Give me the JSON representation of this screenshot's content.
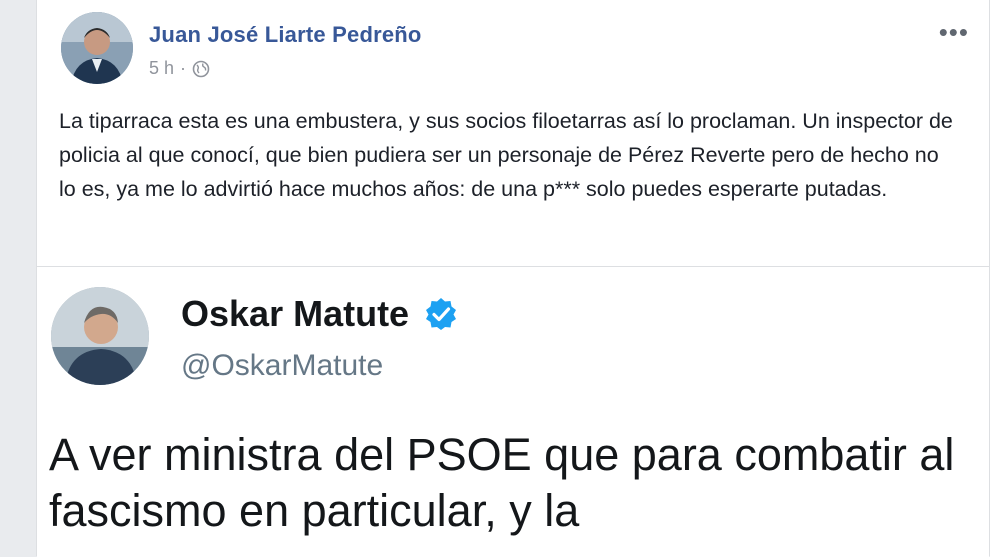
{
  "post": {
    "author": "Juan José Liarte Pedreño",
    "timestamp": "5 h",
    "separator": "·",
    "privacy_icon": "globe-icon",
    "more_label": "•••",
    "text": "La tiparraca esta es una embustera, y sus socios filoetarras así lo proclaman. Un inspector de policia al que conocí, que bien pudiera ser un personaje de Pérez Reverte pero de hecho no lo es, ya me lo advirtió hace muchos años: de una p*** solo puedes esperarte putadas."
  },
  "tweet": {
    "name": "Oskar Matute",
    "verified_icon": "verified-badge-icon",
    "handle": "@OskarMatute",
    "text": "A ver ministra del PSOE que para combatir al fascismo en particular, y la"
  },
  "colors": {
    "facebook_link": "#385898",
    "twitter_verified": "#1da1f2",
    "meta_gray": "#90949c",
    "handle_gray": "#657786"
  }
}
